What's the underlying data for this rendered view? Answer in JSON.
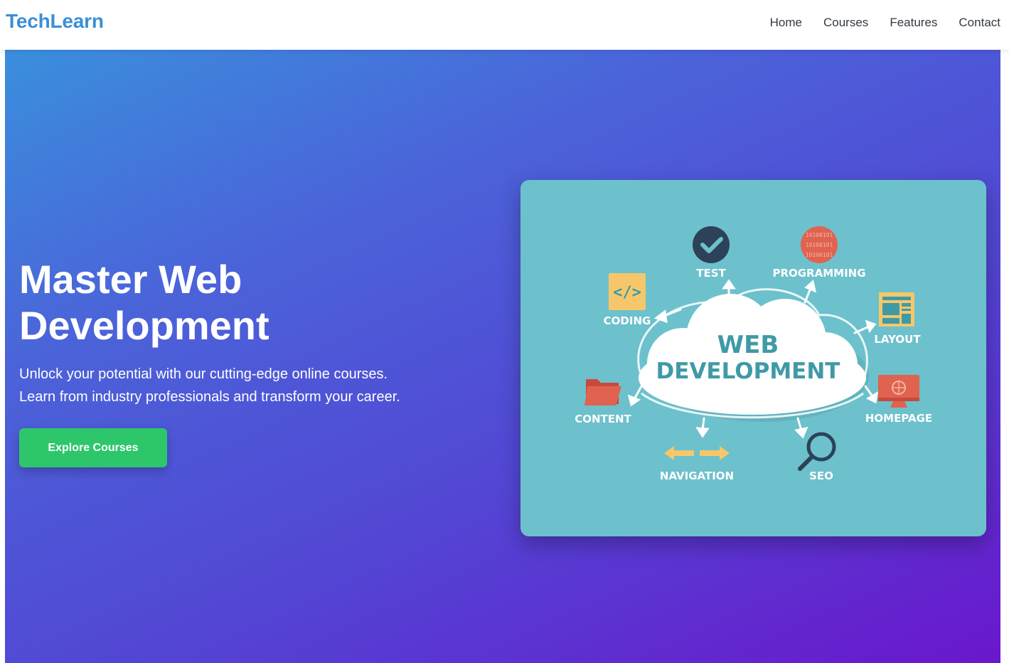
{
  "header": {
    "brand": "TechLearn",
    "nav": [
      "Home",
      "Courses",
      "Features",
      "Contact"
    ]
  },
  "hero": {
    "title_line1": "Master Web",
    "title_line2": "Development",
    "subtitle_line1": "Unlock your potential with our cutting-edge online courses.",
    "subtitle_line2": "Learn from industry professionals and transform your career.",
    "cta_label": "Explore Courses"
  },
  "illustration": {
    "center_line1": "WEB",
    "center_line2": "DEVELOPMENT",
    "labels": {
      "test": "TEST",
      "programming": "PROGRAMMING",
      "coding": "CODING",
      "layout": "LAYOUT",
      "content": "CONTENT",
      "homepage": "HOMEPAGE",
      "navigation": "NAVIGATION",
      "seo": "SEO"
    },
    "code_glyph": "</>",
    "binary_text": "10100101"
  },
  "colors": {
    "brand": "#3a8fd6",
    "cta": "#2ec66a",
    "card_bg": "#6cc1cc",
    "cloud_text": "#3f9aa6"
  }
}
